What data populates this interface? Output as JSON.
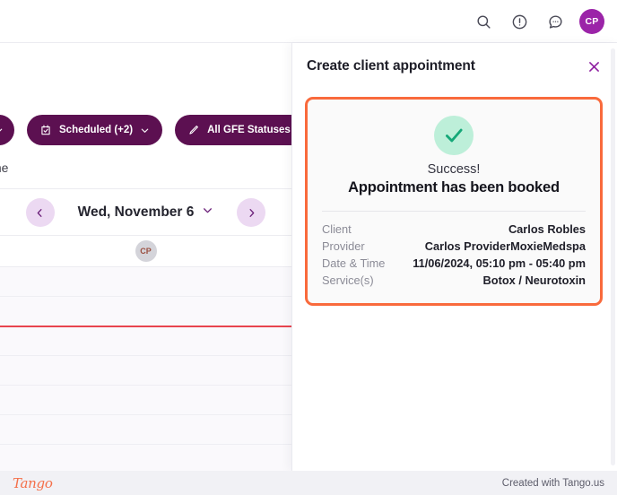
{
  "header": {
    "icons": [
      {
        "name": "search-icon",
        "label": "Search"
      },
      {
        "name": "alert-icon",
        "label": "Alerts"
      },
      {
        "name": "chat-icon",
        "label": "Chat"
      }
    ],
    "avatar_initials": "CP"
  },
  "calendar": {
    "filters": [
      {
        "label": "",
        "icon": "chevron-down-icon",
        "cut": true
      },
      {
        "label": "Scheduled (+2)",
        "icon": "calendar-check-icon"
      },
      {
        "label": "All GFE Statuses",
        "icon": "pencil-icon"
      }
    ],
    "time_column_label": "me",
    "date_label": "Wed, November 6",
    "prev_label": "‹",
    "next_label": "›",
    "provider_initials": "CP"
  },
  "panel": {
    "title": "Create client appointment",
    "close_label": "✕",
    "success": {
      "status_word": "Success!",
      "headline": "Appointment has been booked",
      "check_icon": "check-icon",
      "details": [
        {
          "label": "Client",
          "value": "Carlos Robles"
        },
        {
          "label": "Provider",
          "value": "Carlos ProviderMoxieMedspa"
        },
        {
          "label": "Date & Time",
          "value": "11/06/2024, 05:10 pm - 05:40 pm"
        },
        {
          "label": "Service(s)",
          "value": "Botox / Neurotoxin"
        }
      ]
    }
  },
  "footer": {
    "logo_text": "Tango",
    "credit_text": "Created with Tango.us"
  },
  "colors": {
    "accent_purple": "#9b24a8",
    "pill_purple": "#5c1051",
    "highlight_orange": "#f96a3c",
    "success_green": "#1aa97a",
    "success_bg": "#bdefd9",
    "now_line_red": "#e8454f"
  }
}
